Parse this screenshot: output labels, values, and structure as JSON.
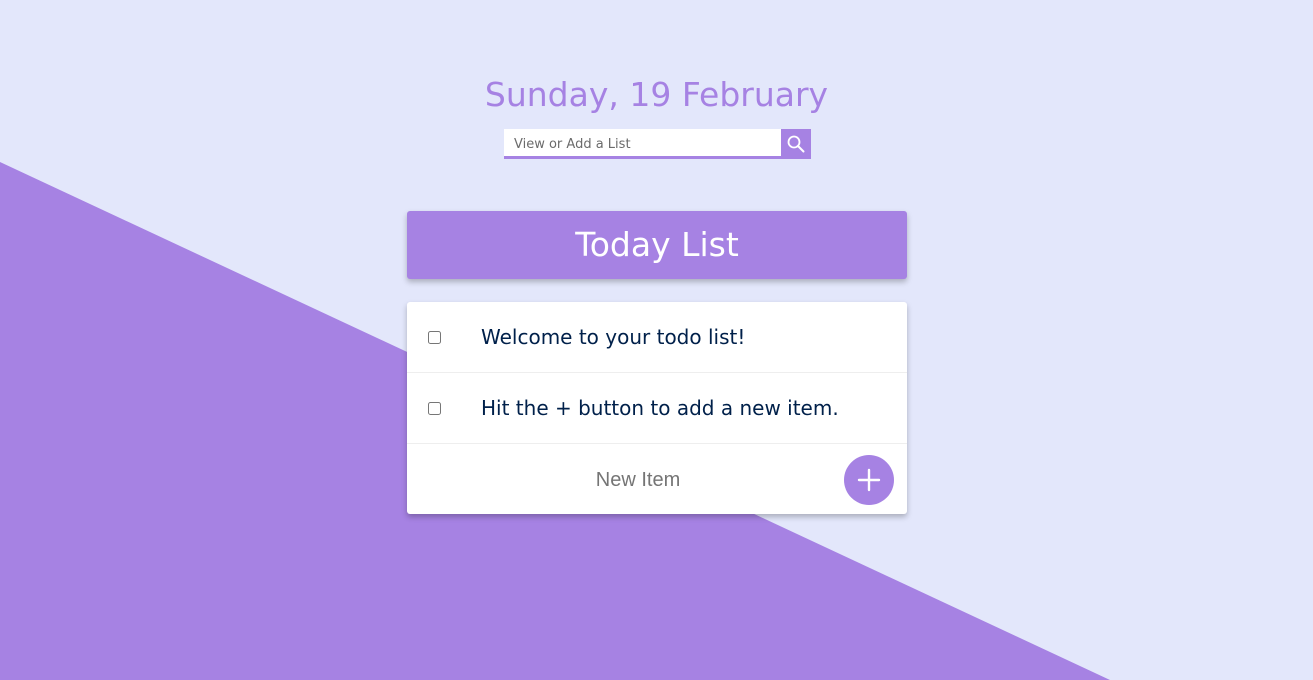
{
  "colors": {
    "background": "#e3e7fb",
    "accent": "#a682e3",
    "text_dark": "#00204a",
    "card": "#ffffff"
  },
  "header": {
    "date": "Sunday, 19 February"
  },
  "search": {
    "placeholder": "View or Add a List",
    "button_icon": "search-icon"
  },
  "list": {
    "title": "Today List",
    "items": [
      {
        "text": "Welcome to your todo list!",
        "checked": false
      },
      {
        "text": "Hit the + button to add a new item.",
        "checked": false
      }
    ],
    "new_item_placeholder": "New Item",
    "add_button_icon": "plus-icon"
  }
}
